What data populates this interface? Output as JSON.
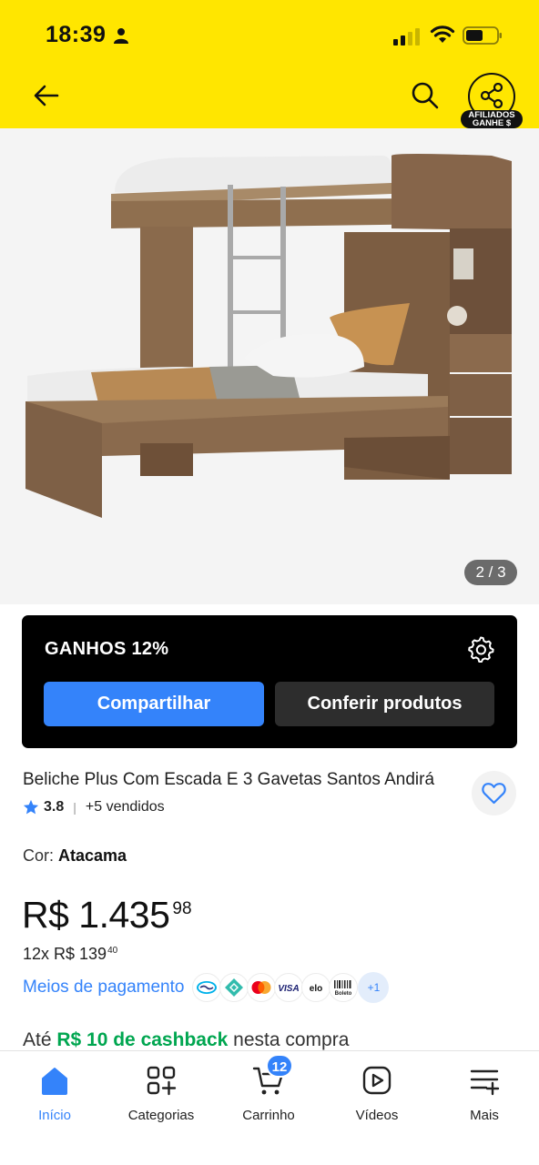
{
  "status_bar": {
    "time": "18:39"
  },
  "header": {
    "affiliate_badge_line1": "AFILIADOS",
    "affiliate_badge_line2": "GANHE $"
  },
  "gallery": {
    "page_indicator": "2 / 3",
    "current": 2,
    "total": 3
  },
  "earnings": {
    "title": "GANHOS 12%",
    "share_button": "Compartilhar",
    "products_button": "Conferir produtos"
  },
  "product": {
    "title": "Beliche Plus Com Escada E 3 Gavetas Santos Andirá",
    "rating": "3.8",
    "sold": "+5 vendidos",
    "color_label": "Cor: ",
    "color_value": "Atacama",
    "price_main": "R$ 1.435",
    "price_cents": "98",
    "installments": "12x R$ 139",
    "installments_cents": "40",
    "payment_link": "Meios de pagamento",
    "payment_methods": [
      "mercado-pago-icon",
      "pix-icon",
      "mastercard-icon",
      "visa-icon",
      "elo-icon",
      "boleto-icon"
    ],
    "payment_more": "+1",
    "cashback_prefix": "Até ",
    "cashback_amount": "R$ 10 de cashback",
    "cashback_suffix": " nesta compra"
  },
  "tabbar": {
    "items": [
      {
        "label": "Início",
        "icon": "home-icon",
        "active": true
      },
      {
        "label": "Categorias",
        "icon": "categories-icon",
        "active": false
      },
      {
        "label": "Carrinho",
        "icon": "cart-icon",
        "active": false
      },
      {
        "label": "Vídeos",
        "icon": "video-icon",
        "active": false
      },
      {
        "label": "Mais",
        "icon": "menu-more-icon",
        "active": false
      }
    ],
    "cart_count": "12"
  },
  "colors": {
    "header_yellow": "#ffe600",
    "primary_blue": "#3483fa",
    "cashback_green": "#00a650"
  }
}
